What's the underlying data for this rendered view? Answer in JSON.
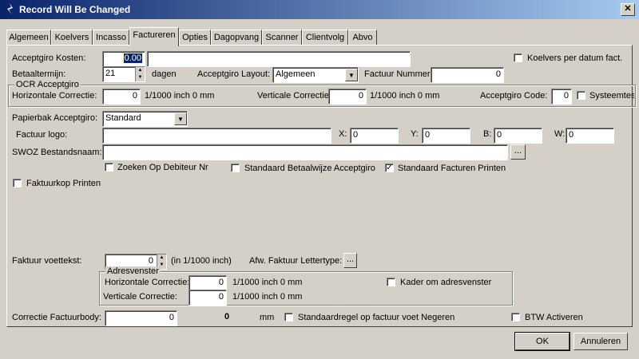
{
  "window": {
    "title": "Record Will Be Changed",
    "close_glyph": "✕"
  },
  "tabs": [
    "Algemeen",
    "Koelvers",
    "Incasso",
    "Factureren",
    "Opties",
    "Dagopvang",
    "Scanner",
    "Clientvolg",
    "Abvo"
  ],
  "active_tab": "Factureren",
  "form": {
    "acceptgiro_kosten_label": "Acceptgiro Kosten:",
    "acceptgiro_kosten_value": "0.00",
    "acceptgiro_kosten_text": "",
    "koelvers_per_datum_label": "Koelvers per datum fact.",
    "betaaltermijn_label": "Betaaltermijn:",
    "betaaltermijn_value": "21",
    "dagen_label": "dagen",
    "acceptgiro_layout_label": "Acceptgiro Layout:",
    "acceptgiro_layout_value": "Algemeen",
    "factuur_nummer_label": "Factuur Nummer:",
    "factuur_nummer_value": "0",
    "ocr_group_label": "OCR Acceptgiro",
    "horiz_corr_label": "Horizontale Correctie:",
    "horiz_corr_value": "0",
    "horiz_corr_unit": "1/1000 inch 0 mm",
    "vert_corr_label": "Verticale Correctie:",
    "vert_corr_value": "0",
    "vert_corr_unit": "1/1000 inch 0 mm",
    "acceptgiro_code_label": "Acceptgiro Code:",
    "acceptgiro_code_value": "0",
    "systeemtest_label": "Systeemtest",
    "papierbak_label": "Papierbak Acceptgiro:",
    "papierbak_value": "Standard",
    "factuur_logo_label": "Factuur logo:",
    "factuur_logo_value": "",
    "x_label": "X:",
    "x_value": "0",
    "y_label": "Y:",
    "y_value": "0",
    "b_label": "B:",
    "b_value": "0",
    "w_label": "W:",
    "w_value": "0",
    "swoz_label": "SWOZ Bestandsnaam:",
    "swoz_value": "",
    "browse_label": "...",
    "zoeken_label": "Zoeken Op Debiteur Nr",
    "std_betaalwijze_label": "Standaard Betaalwijze Acceptgiro",
    "std_facturen_label": "Standaard Facturen Printen",
    "faktuurkop_label": "Faktuurkop Printen",
    "voettekst_label": "Faktuur voettekst:",
    "voettekst_value": "0",
    "voettekst_unit": "(in 1/1000 inch)",
    "afw_lettertype_label": "Afw. Faktuur Lettertype:",
    "afw_lettertype_btn": "...",
    "adres_group_label": "Adresvenster",
    "adres_horiz_label": "Horizontale Correctie:",
    "adres_horiz_value": "0",
    "adres_horiz_unit": "1/1000 inch 0 mm",
    "adres_vert_label": "Verticale Correctie:",
    "adres_vert_value": "0",
    "adres_vert_unit": "1/1000 inch 0 mm",
    "kader_label": "Kader om adresvenster",
    "correctie_body_label": "Correctie Factuurbody:",
    "correctie_body_value": "0",
    "correctie_body_readout": "0",
    "mm_label": "mm",
    "standaardregel_label": "Standaardregel op factuur voet Negeren",
    "btw_label": "BTW Activeren"
  },
  "checkboxes": {
    "koelvers_per_datum": false,
    "systeemtest": false,
    "zoeken": false,
    "std_betaalwijze": false,
    "std_facturen": true,
    "faktuurkop": false,
    "kader": false,
    "standaardregel": false,
    "btw": false
  },
  "buttons": {
    "ok": "OK",
    "cancel": "Annuleren"
  },
  "glyphs": {
    "check": "✓",
    "up": "▲",
    "down": "▼",
    "drop": "▼"
  }
}
